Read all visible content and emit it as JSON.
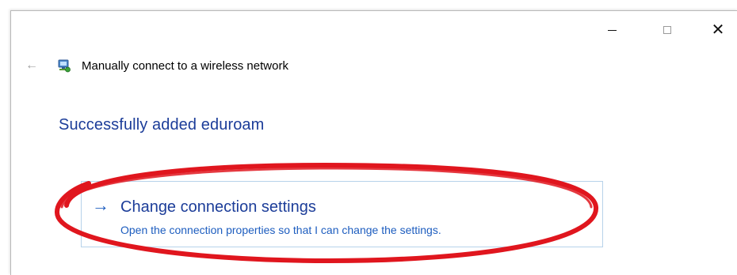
{
  "window": {
    "header_title": "Manually connect to a wireless network",
    "success_message": "Successfully added eduroam",
    "controls": {
      "minimize": "—",
      "close": "✕"
    }
  },
  "command_link": {
    "arrow": "→",
    "title": "Change connection settings",
    "description": "Open the connection properties so that I can change the settings."
  },
  "back_arrow": "←",
  "colors": {
    "heading_blue": "#1c3d99",
    "link_blue": "#1d5dbf",
    "annotation_red": "#e0161e"
  },
  "icons": {
    "back": "back-arrow-icon",
    "network": "wireless-network-icon",
    "link": "arrow-right-icon"
  }
}
